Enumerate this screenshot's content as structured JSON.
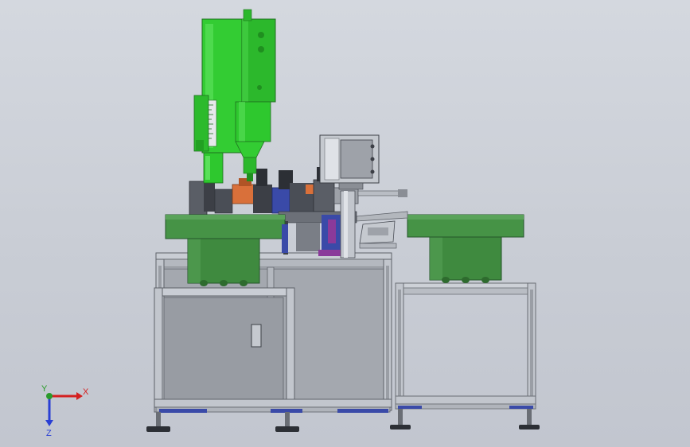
{
  "viewport": {
    "background": "#c9cdd5",
    "colors": {
      "ultrasonic_green": "#2ec82e",
      "ultrasonic_dark_green": "#1f8f1f",
      "bowl_green": "#3f8a3f",
      "bowl_dark_green": "#2e6b2e",
      "frame_gray": "#a7abb3",
      "frame_light": "#c7cbd2",
      "panel_gray": "#9ea2a9",
      "fixture_blue": "#3a4aa8",
      "fixture_orange": "#d9703a",
      "fixture_purple": "#8a3a9a",
      "dark_parts": "#3c3f46"
    },
    "objects": {
      "ultrasonic_welder": "ultrasonic-welder",
      "left_vibratory_bowl": "vibratory-bowl-left",
      "right_vibratory_bowl": "vibratory-bowl-right",
      "main_cabinet": "main-cabinet",
      "side_frame": "side-frame",
      "touch_screen": "hmi-screen",
      "fixtures": "assembly-fixtures"
    }
  },
  "triad": {
    "x_label": "X",
    "y_label": "Y",
    "z_label": "Z",
    "x_color": "#d42020",
    "y_color": "#2a9a2a",
    "z_color": "#2a3fd4"
  }
}
